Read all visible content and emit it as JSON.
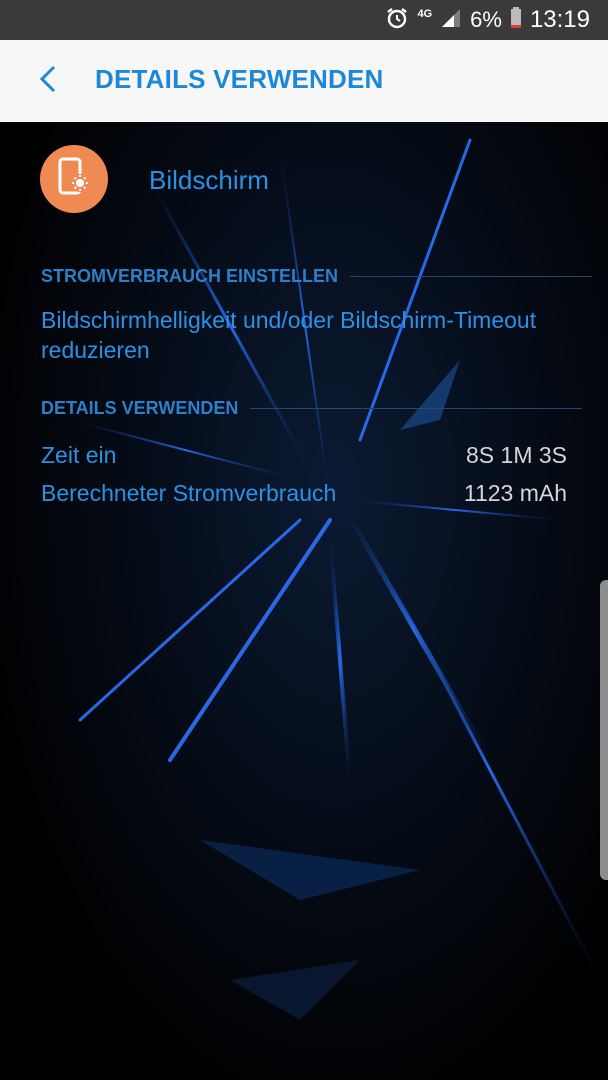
{
  "status_bar": {
    "network": "4G",
    "battery": "6%",
    "time": "13:19"
  },
  "app_bar": {
    "title": "DETAILS VERWENDEN"
  },
  "app": {
    "name": "Bildschirm",
    "icon": "screen-brightness-icon",
    "icon_color": "#ee8a52"
  },
  "section_power": {
    "header": "STROMVERBRAUCH EINSTELLEN",
    "description": "Bildschirmhelligkeit und/oder Bildschirm-Timeout reduzieren"
  },
  "section_details": {
    "header": "DETAILS VERWENDEN",
    "rows": [
      {
        "label": "Zeit ein",
        "value": "8S 1M 3S"
      },
      {
        "label": "Berechneter Stromverbrauch",
        "value": "1123 mAh"
      }
    ]
  },
  "colors": {
    "accent": "#2a92e6",
    "header": "#2d7fc9",
    "value_text": "#d6d6d6",
    "app_bar_bg": "#f7f7f7",
    "status_bar_bg": "#3a3a3a"
  }
}
